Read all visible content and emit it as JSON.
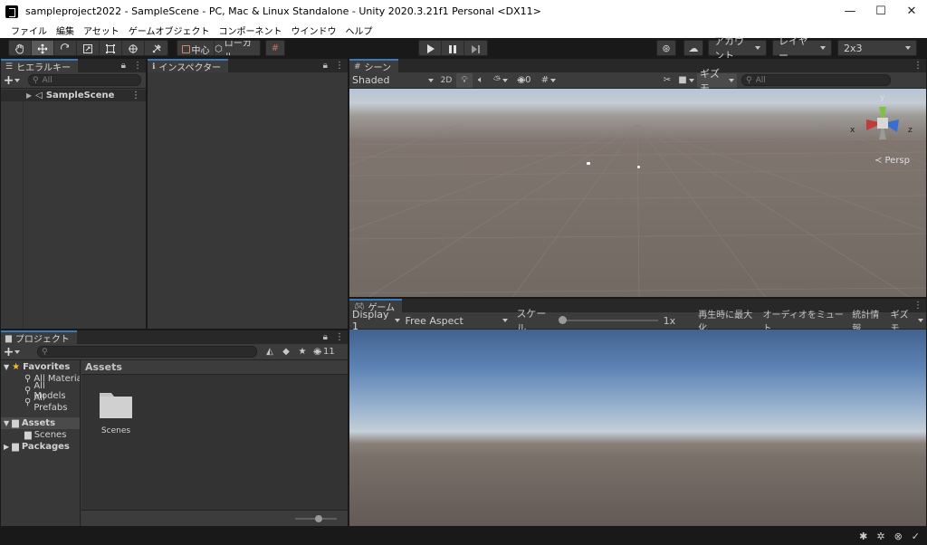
{
  "window": {
    "title": "sampleproject2022 - SampleScene - PC, Mac & Linux Standalone - Unity 2020.3.21f1 Personal <DX11>",
    "minimize": "—",
    "maximize": "☐",
    "close": "✕"
  },
  "menu": [
    "ファイル",
    "編集",
    "アセット",
    "ゲームオブジェクト",
    "コンポーネント",
    "ウインドウ",
    "ヘルプ"
  ],
  "toolbar": {
    "pivot_label": "中心",
    "space_label": "ローカル",
    "account_label": "アカウント",
    "layers_label": "レイヤー",
    "layout_label": "2x3"
  },
  "hierarchy": {
    "tab_label": "ヒエラルキー",
    "search_placeholder": "All",
    "scene_item": "SampleScene"
  },
  "inspector": {
    "tab_label": "インスペクター"
  },
  "scene": {
    "tab_label": "シーン",
    "shading_mode": "Shaded",
    "mode_2d": "2D",
    "hidden_count": "0",
    "gizmos_label": "ギズモ",
    "search_placeholder": "All",
    "persp_label": "≺ Persp",
    "axis_y": "y",
    "axis_x": "x",
    "axis_z": "z"
  },
  "game": {
    "tab_label": "ゲーム",
    "display": "Display 1",
    "aspect": "Free Aspect",
    "scale_label": "スケール",
    "scale_value": "1x",
    "maximize_on_play": "再生時に最大化",
    "mute_audio": "オーディオをミュート",
    "stats": "統計情報",
    "gizmos": "ギズモ"
  },
  "project": {
    "tab_label": "プロジェクト",
    "hidden_packages_count": "11",
    "favorites_label": "Favorites",
    "favorites": [
      "All Materia",
      "All Models",
      "All Prefabs"
    ],
    "assets_label": "Assets",
    "scenes_label": "Scenes",
    "packages_label": "Packages",
    "breadcrumb": "Assets",
    "folder_name": "Scenes"
  },
  "colors": {
    "accent_tab": "#3a79bb",
    "panel_bg": "#383838",
    "toolbar_bg": "#191919"
  }
}
